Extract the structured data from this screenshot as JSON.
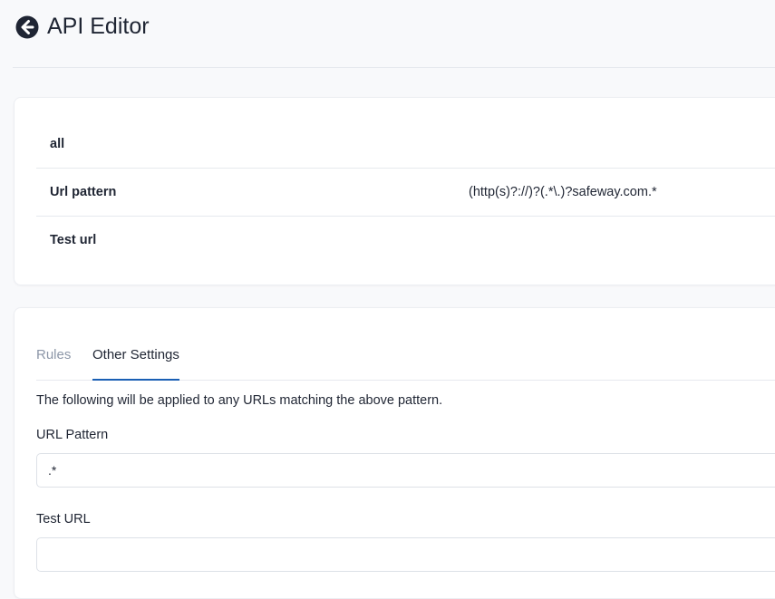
{
  "header": {
    "title": "API Editor"
  },
  "summary": {
    "rows": [
      {
        "label": "all",
        "value": ""
      },
      {
        "label": "Url pattern",
        "value": "(http(s)?://)?(.*\\.)?safeway.com.*"
      },
      {
        "label": "Test url",
        "value": ""
      }
    ]
  },
  "settings": {
    "tabs": [
      {
        "label": "Rules",
        "active": false
      },
      {
        "label": "Other Settings",
        "active": true
      }
    ],
    "description": "The following will be applied to any URLs matching the above pattern.",
    "url_pattern": {
      "label": "URL Pattern",
      "value": ".*"
    },
    "test_url": {
      "label": "Test URL",
      "value": ""
    }
  },
  "colors": {
    "accent": "#1a5fb4",
    "text": "#1f2533",
    "muted": "#8d97a8"
  }
}
